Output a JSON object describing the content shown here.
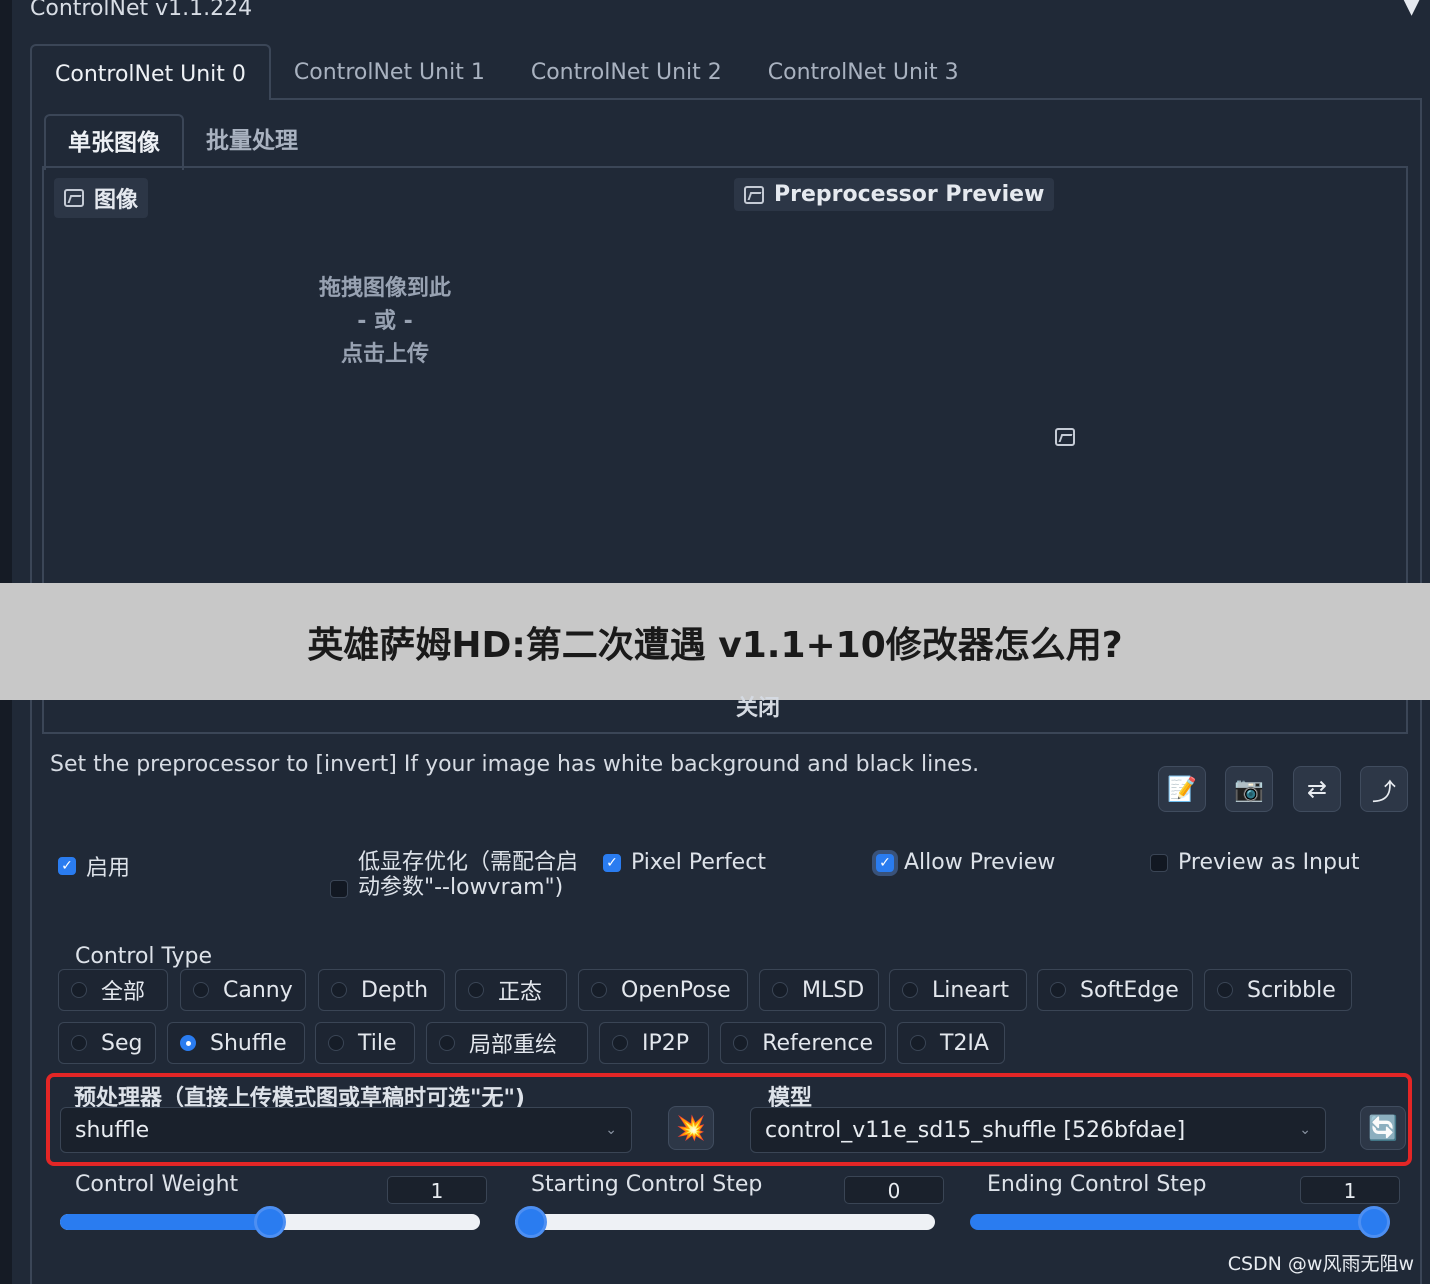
{
  "panel": {
    "title": "ControlNet v1.1.224",
    "collapse_glyph": "▼"
  },
  "unit_tabs": [
    "ControlNet Unit 0",
    "ControlNet Unit 1",
    "ControlNet Unit 2",
    "ControlNet Unit 3"
  ],
  "mode_tabs": [
    "单张图像",
    "批量处理"
  ],
  "image_panel": {
    "label": "图像",
    "upload_line1": "拖拽图像到此",
    "upload_line2": "- 或 -",
    "upload_line3": "点击上传",
    "preview_label": "Preprocessor Preview"
  },
  "banner": {
    "text": "英雄萨姆HD:第二次遭遇 v1.1+10修改器怎么用?"
  },
  "close_label": "关闭",
  "hint": "Set the preprocessor to [invert] If your image has white background and black lines.",
  "toolbar_icons": [
    "edit-icon",
    "camera-icon",
    "swap-icon",
    "upload-arrow-icon"
  ],
  "toolbar_glyphs": [
    "📝",
    "📷",
    "⇄",
    "⤴"
  ],
  "options": {
    "enable": {
      "label": "启用",
      "checked": true
    },
    "lowvram": {
      "label": "低显存优化（需配合启动参数\"--lowvram\")",
      "checked": false
    },
    "pixel_perfect": {
      "label": "Pixel Perfect",
      "checked": true
    },
    "allow_preview": {
      "label": "Allow Preview",
      "checked": true
    },
    "preview_as_input": {
      "label": "Preview as Input",
      "checked": false
    }
  },
  "control_type": {
    "label": "Control Type",
    "selected": "Shuffle",
    "row1": [
      "全部",
      "Canny",
      "Depth",
      "正态",
      "OpenPose",
      "MLSD",
      "Lineart",
      "SoftEdge",
      "Scribble"
    ],
    "row2": [
      "Seg",
      "Shuffle",
      "Tile",
      "局部重绘",
      "IP2P",
      "Reference",
      "T2IA"
    ]
  },
  "preprocessor": {
    "label": "预处理器（直接上传模式图或草稿时可选\"无\")",
    "value": "shuffle",
    "run_glyph": "💥"
  },
  "model": {
    "label": "模型",
    "value": "control_v11e_sd15_shuffle [526bfdae]",
    "refresh_glyph": "🔄"
  },
  "sliders": {
    "weight": {
      "label": "Control Weight",
      "value": "1",
      "fraction": 0.5
    },
    "start": {
      "label": "Starting Control Step",
      "value": "0",
      "fraction": 0.0
    },
    "end": {
      "label": "Ending Control Step",
      "value": "1",
      "fraction": 1.0
    }
  },
  "accent_color": "#2a7cf0",
  "highlight_color": "#e32626",
  "watermark": "CSDN @w风雨无阻w"
}
